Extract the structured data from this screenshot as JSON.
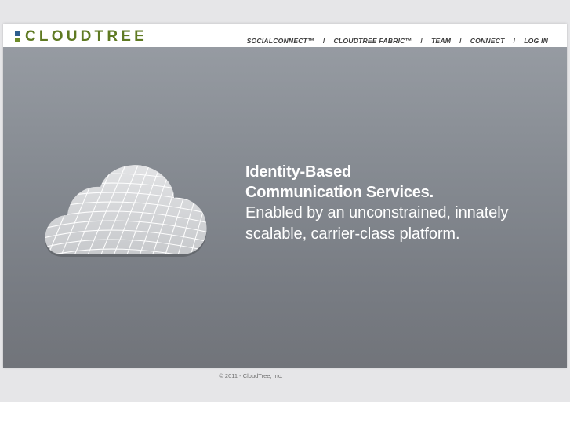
{
  "logo": {
    "text": "CLOUDTREE",
    "colors": {
      "mark_top": "#2d5e8e",
      "mark_bottom": "#6e8c2a",
      "text": "#5f7a22"
    }
  },
  "nav": {
    "items": [
      {
        "label": "SOCIALCONNECT™"
      },
      {
        "label": "CLOUDTREE FABRIC™"
      },
      {
        "label": "TEAM"
      },
      {
        "label": "CONNECT"
      },
      {
        "label": "LOG IN"
      }
    ],
    "separator": "/"
  },
  "hero": {
    "line1": "Identity-Based",
    "line2": "Communication Services.",
    "line3": "Enabled by an unconstrained, innately",
    "line4": "scalable, carrier-class platform.",
    "cloud_icon": "cloud-icon"
  },
  "footer": {
    "copyright": "© 2011 - CloudTree, Inc."
  }
}
